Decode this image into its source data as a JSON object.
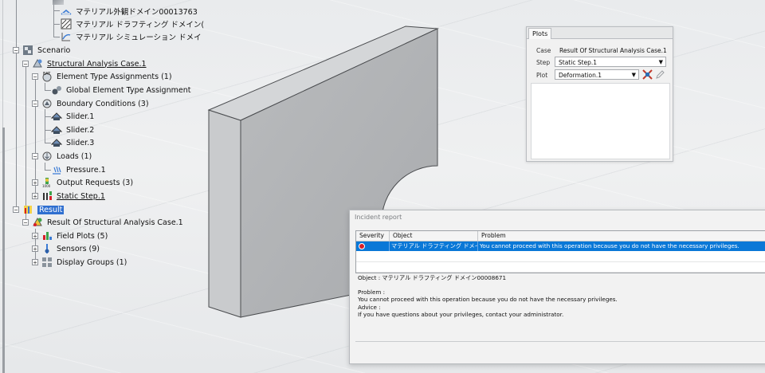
{
  "tree": {
    "nodes": [
      {
        "label": "マテリアル外観ドメイン00013763",
        "icon": "material-appearance-icon"
      },
      {
        "label": "マテリアル ドラフティング ドメイン(",
        "icon": "material-drafting-icon"
      },
      {
        "label": "マテリアル シミュレーション ドメイ",
        "icon": "material-simulation-icon"
      },
      {
        "label": "Scenario",
        "icon": "scenario-icon"
      },
      {
        "label": "Structural Analysis Case.1",
        "icon": "analysis-case-icon"
      },
      {
        "label": "Element Type Assignments (1)",
        "icon": "element-type-icon"
      },
      {
        "label": "Global Element Type Assignment",
        "icon": "global-element-icon"
      },
      {
        "label": "Boundary Conditions (3)",
        "icon": "boundary-conditions-icon"
      },
      {
        "label": "Slider.1",
        "icon": "slider-icon"
      },
      {
        "label": "Slider.2",
        "icon": "slider-icon"
      },
      {
        "label": "Slider.3",
        "icon": "slider-icon"
      },
      {
        "label": "Loads (1)",
        "icon": "loads-icon"
      },
      {
        "label": "Pressure.1",
        "icon": "pressure-icon"
      },
      {
        "label": "Output Requests (3)",
        "icon": "output-requests-icon"
      },
      {
        "label": "Static Step.1",
        "icon": "static-step-icon"
      },
      {
        "label": "Result",
        "icon": "result-icon"
      },
      {
        "label": "Result Of Structural Analysis Case.1",
        "icon": "result-case-icon"
      },
      {
        "label": "Field Plots (5)",
        "icon": "field-plots-icon"
      },
      {
        "label": "Sensors (9)",
        "icon": "sensors-icon"
      },
      {
        "label": "Display Groups (1)",
        "icon": "display-groups-icon"
      }
    ]
  },
  "plots": {
    "tab": "Plots",
    "case_label": "Case",
    "case_value": "Result Of Structural Analysis Case.1",
    "step_label": "Step",
    "step_value": "Static Step.1",
    "plot_label": "Plot",
    "plot_value": "Deformation.1"
  },
  "incident": {
    "title": "Incident report",
    "columns": [
      "Severity",
      "Object",
      "Problem"
    ],
    "row": {
      "severity": "error",
      "object": "マテリアル ドラフティング ドメイン000...",
      "problem": "You cannot proceed with this operation because you do not have the necessary privileges."
    },
    "object_line": "Object : マテリアル ドラフティング ドメイン00008671",
    "problem_heading": "Problem :",
    "problem_text": "You cannot proceed with this operation because you do not have the necessary privileges.",
    "advice_heading": "Advice :",
    "advice_text": "If you have questions about your privileges, contact your administrator."
  },
  "colors": {
    "selection": "#2f6fd0",
    "row_highlight": "#0a78d7",
    "error": "#d7202a"
  }
}
